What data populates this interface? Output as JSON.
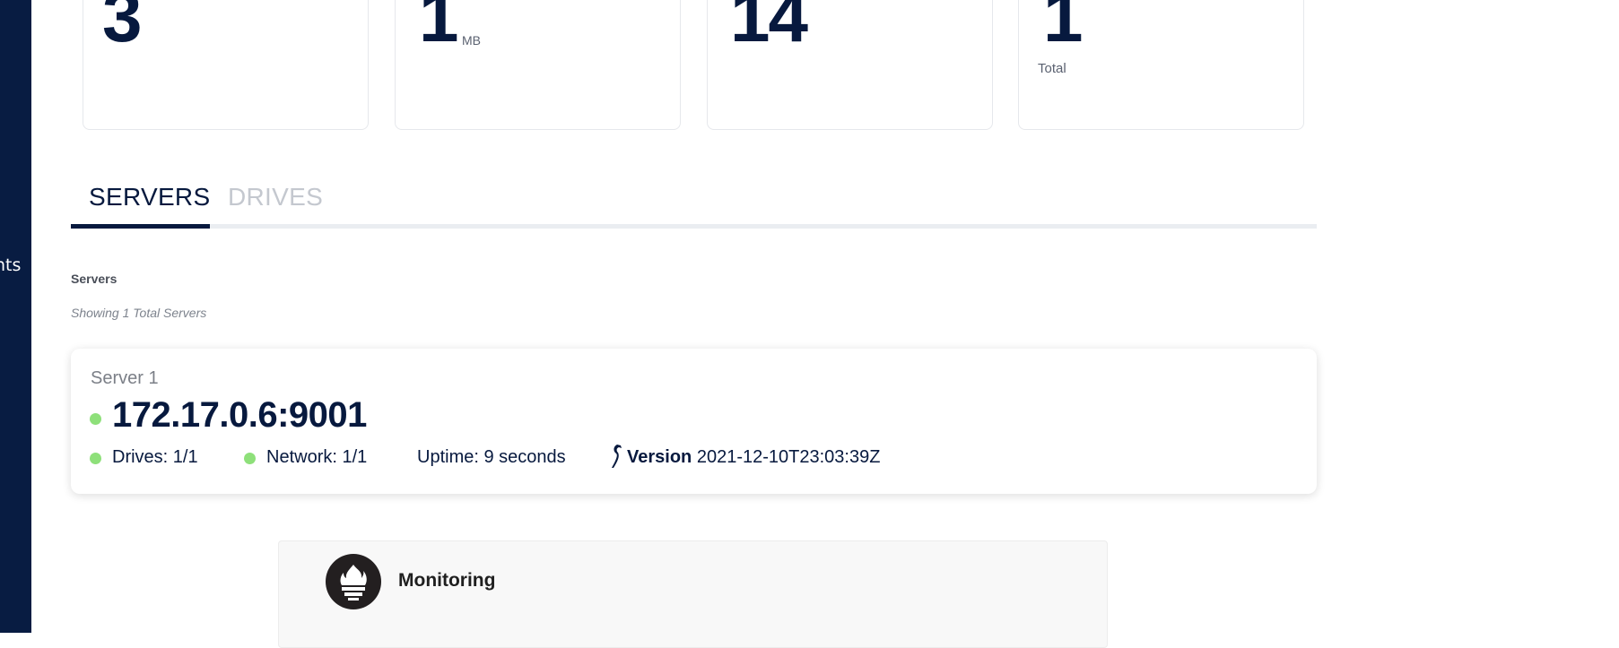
{
  "sidebar": {
    "partial_label": "nts"
  },
  "stats": [
    {
      "value": "3",
      "unit": "",
      "sub": ""
    },
    {
      "value": "1",
      "unit": "MB",
      "sub": ""
    },
    {
      "value": "14",
      "unit": "",
      "sub": ""
    },
    {
      "value": "1",
      "unit": "",
      "sub": "Total"
    }
  ],
  "tabs": [
    {
      "label": "SERVERS",
      "active": true
    },
    {
      "label": "DRIVES",
      "active": false
    }
  ],
  "section": {
    "title": "Servers",
    "subtitle": "Showing 1 Total Servers"
  },
  "server": {
    "name": "Server 1",
    "address": "172.17.0.6:9001",
    "drives": "Drives: 1/1",
    "network": "Network: 1/1",
    "uptime": "Uptime: 9 seconds",
    "version_label": "Version",
    "version_value": "2021-12-10T23:03:39Z",
    "status_color": "#8ee07a"
  },
  "monitoring": {
    "label": "Monitoring",
    "icon": "prometheus-flame-icon"
  },
  "colors": {
    "sidebar": "#081c42",
    "accent": "#07193e",
    "online": "#8ee07a"
  }
}
